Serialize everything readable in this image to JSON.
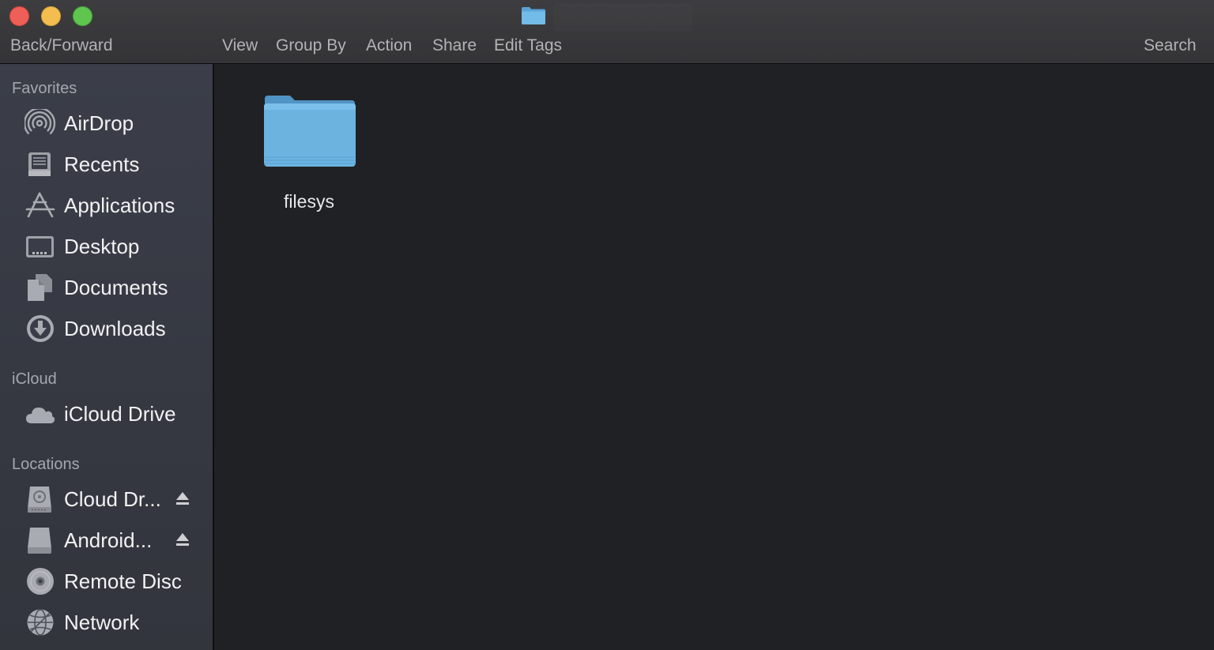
{
  "toolbar": {
    "back_forward": "Back/Forward",
    "view": "View",
    "group_by": "Group By",
    "action": "Action",
    "share": "Share",
    "edit_tags": "Edit Tags",
    "search": "Search"
  },
  "window_icon": "folder-icon",
  "sidebar": {
    "favorites": {
      "header": "Favorites",
      "items": [
        {
          "label": "AirDrop",
          "icon": "airdrop-icon"
        },
        {
          "label": "Recents",
          "icon": "recents-icon"
        },
        {
          "label": "Applications",
          "icon": "applications-icon"
        },
        {
          "label": "Desktop",
          "icon": "desktop-icon"
        },
        {
          "label": "Documents",
          "icon": "documents-icon"
        },
        {
          "label": "Downloads",
          "icon": "downloads-icon"
        }
      ]
    },
    "icloud": {
      "header": "iCloud",
      "items": [
        {
          "label": "iCloud Drive",
          "icon": "icloud-icon"
        }
      ]
    },
    "locations": {
      "header": "Locations",
      "items": [
        {
          "label": "Cloud Dr...",
          "icon": "disk-drive-icon",
          "eject": true
        },
        {
          "label": "Android...",
          "icon": "external-drive-icon",
          "eject": true
        },
        {
          "label": "Remote Disc",
          "icon": "remote-disc-icon"
        },
        {
          "label": "Network",
          "icon": "network-icon"
        }
      ]
    }
  },
  "content": {
    "files": [
      {
        "name": "filesys",
        "icon": "folder-icon"
      }
    ]
  },
  "colors": {
    "close": "#ee5f57",
    "minimize": "#f4bd4f",
    "zoom": "#5fc54f",
    "folder": "#6cb3e0"
  }
}
